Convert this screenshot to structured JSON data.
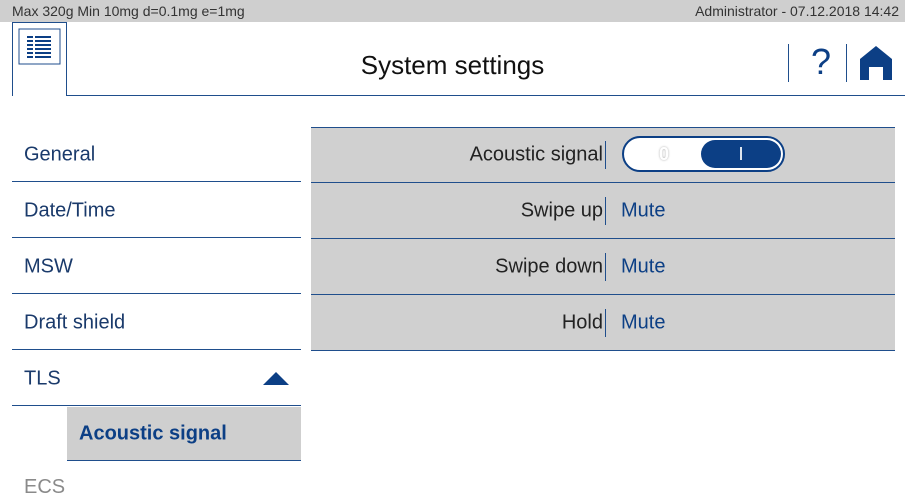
{
  "status_bar": {
    "specs": "Max 320g  Min 10mg  d=0.1mg  e=1mg",
    "user_datetime": "Administrator - 07.12.2018 14:42"
  },
  "header": {
    "title": "System settings",
    "menu_icon": "list-menu-icon",
    "help_label": "?",
    "help_icon": "help-icon",
    "home_icon": "home-icon"
  },
  "sidebar": {
    "items": [
      {
        "label": "General"
      },
      {
        "label": "Date/Time"
      },
      {
        "label": "MSW"
      },
      {
        "label": "Draft shield"
      },
      {
        "label": "TLS",
        "expanded": true,
        "icon": "collapse-triangle-icon"
      },
      {
        "label": "Acoustic signal",
        "selected": true
      },
      {
        "label": "ECS"
      }
    ]
  },
  "settings": {
    "rows": [
      {
        "name": "Acoustic signal",
        "toggle": {
          "off_label": "0",
          "on_label": "I",
          "state": "on"
        }
      },
      {
        "name": "Swipe up",
        "value": "Mute"
      },
      {
        "name": "Swipe down",
        "value": "Mute"
      },
      {
        "name": "Hold",
        "value": "Mute"
      }
    ]
  },
  "colors": {
    "accent": "#0c3f85",
    "panel_bg": "#d0d0d0",
    "status_bg": "#cfcfcf"
  }
}
